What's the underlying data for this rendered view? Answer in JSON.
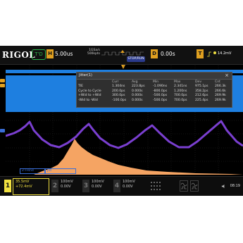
{
  "topbar": {
    "logo": "RIGOL",
    "run_state": "T'D",
    "h_label": "H",
    "timebase": "5.00us",
    "sample_rate_top": "1GSa/s",
    "sample_rate_bottom": "500kpts",
    "stop_label": "STOP/RUN",
    "d_label": "D",
    "delay": "0.00s",
    "t_label": "T",
    "trigger_level": "14.2mV"
  },
  "dialog": {
    "title": "Jitter(1)",
    "close": "×",
    "headers": [
      "",
      "Curr",
      "Avg",
      "Min",
      "Max",
      "Dev",
      "Cnt"
    ],
    "rows": [
      [
        "TIE",
        "1.304ns",
        "223.8ps",
        "-1.090ns",
        "2.341ns",
        "975.1ps",
        "266.3k"
      ],
      [
        "Cycle to Cycle",
        "200.0ps",
        "0.000s",
        "-800.0ps",
        "1.200ns",
        "358.2ps",
        "266.6k"
      ],
      [
        "+Wid to +Wid",
        "300.0ps",
        "0.000s",
        "-500.0ps",
        "700.0ps",
        "212.6ps",
        "269.9k"
      ],
      [
        "-Wid to -Wid",
        "-100.0ps",
        "0.000s",
        "-500.0ps",
        "700.0ps",
        "225.4ps",
        "269.9k"
      ]
    ]
  },
  "zoom": {
    "label": "2:Trend",
    "label2": "Jitt"
  },
  "bottombar": {
    "ch1": {
      "num": "1",
      "scale": "35.5mV",
      "offset": "+72.4mV"
    },
    "ch2": {
      "num": "2",
      "scale": "100mV",
      "offset": "0.00V"
    },
    "ch3": {
      "num": "3",
      "scale": "100mV",
      "offset": "0.00V"
    },
    "ch4": {
      "num": "4",
      "scale": "100mV",
      "offset": "0.00V"
    },
    "time": "08:19"
  },
  "colors": {
    "ch1": "#f0e040",
    "ch2": "#33d1e0",
    "ch3": "#e04ab0",
    "ch4": "#3a6fd8",
    "trend": "#7a3fd0",
    "histogram": "#f5a463",
    "digital_band": "#1e7fe0"
  }
}
